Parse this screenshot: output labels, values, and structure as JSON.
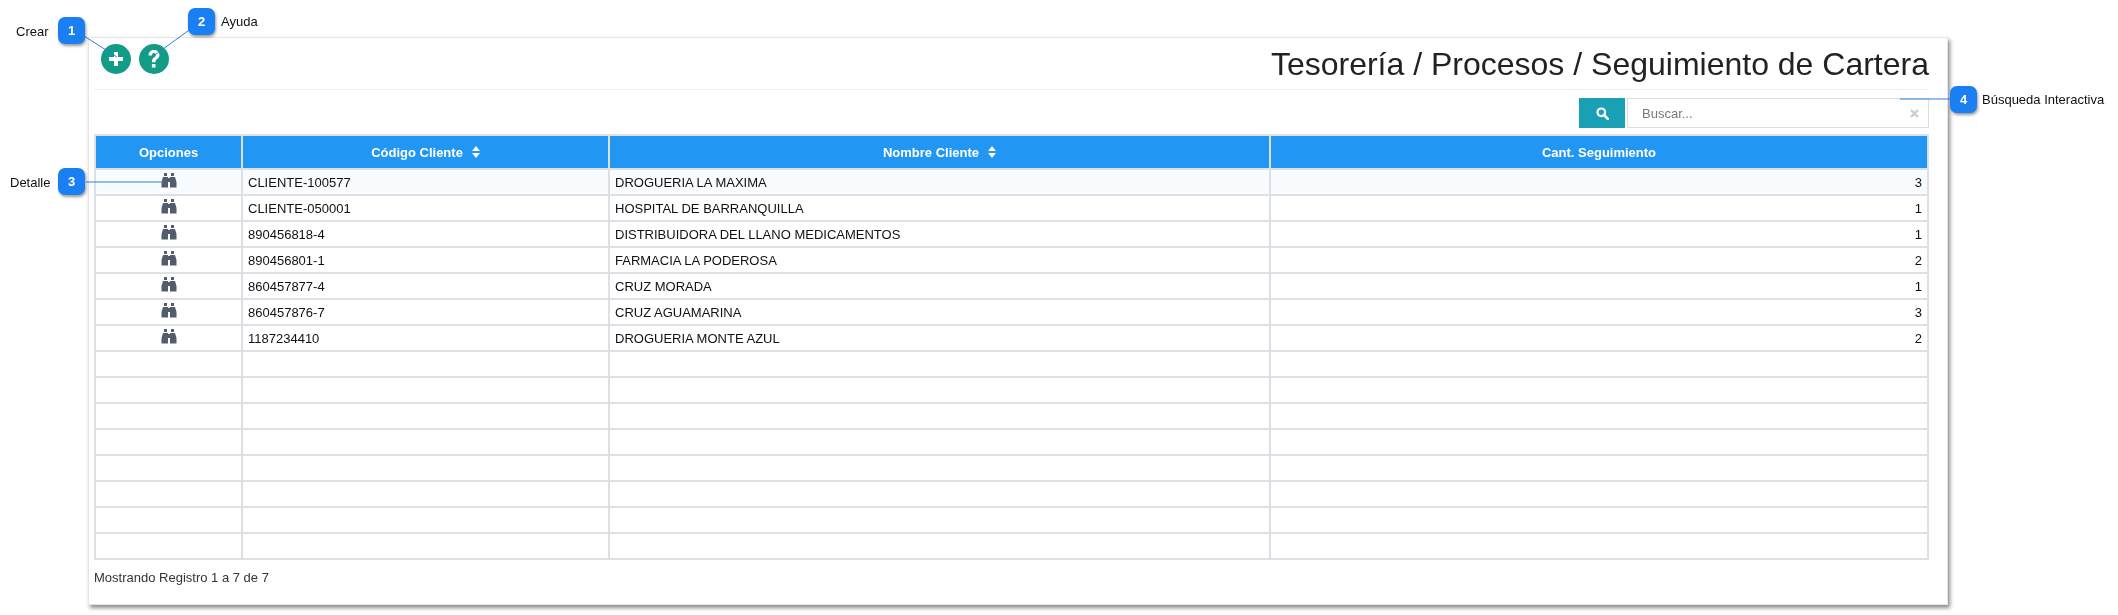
{
  "toolbar": {
    "buttons": [
      {
        "kind": "add"
      },
      {
        "kind": "help"
      }
    ]
  },
  "title": "Tesorería / Procesos / Seguimiento de Cartera",
  "search": {
    "placeholder": "Buscar..."
  },
  "table": {
    "columns": [
      {
        "label": "Opciones",
        "sortable": false
      },
      {
        "label": "Código Cliente",
        "sortable": true
      },
      {
        "label": "Nombre Cliente",
        "sortable": true
      },
      {
        "label": "Cant. Seguimiento",
        "sortable": false
      }
    ],
    "rows": [
      {
        "code": "CLIENTE-100577",
        "name": "DROGUERIA LA MAXIMA",
        "count": "3"
      },
      {
        "code": "CLIENTE-050001",
        "name": "HOSPITAL DE BARRANQUILLA",
        "count": "1"
      },
      {
        "code": "890456818-4",
        "name": "DISTRIBUIDORA DEL LLANO MEDICAMENTOS",
        "count": "1"
      },
      {
        "code": "890456801-1",
        "name": "FARMACIA LA PODEROSA",
        "count": "2"
      },
      {
        "code": "860457877-4",
        "name": "CRUZ MORADA",
        "count": "1"
      },
      {
        "code": "860457876-7",
        "name": "CRUZ AGUAMARINA",
        "count": "3"
      },
      {
        "code": "1187234410",
        "name": "DROGUERIA MONTE AZUL",
        "count": "2"
      }
    ]
  },
  "footer": "Mostrando Registro 1 a 7 de 7",
  "callouts": [
    {
      "number": "1",
      "label": "Crear"
    },
    {
      "number": "2",
      "label": "Ayuda"
    },
    {
      "number": "3",
      "label": "Detalle"
    },
    {
      "number": "4",
      "label": "Búsqueda Interactiva"
    }
  ]
}
